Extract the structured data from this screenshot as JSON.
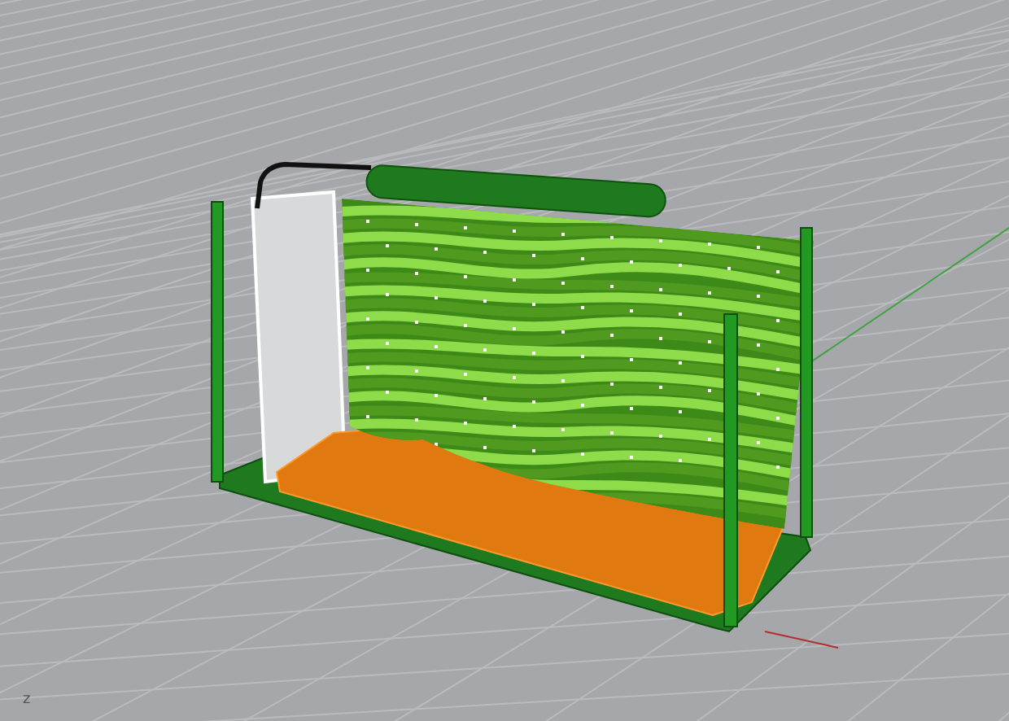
{
  "viewport": {
    "perspective": true,
    "axis_label": "z"
  }
}
